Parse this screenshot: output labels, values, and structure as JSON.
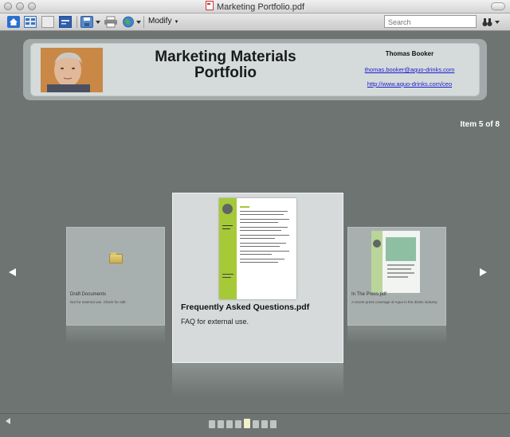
{
  "window": {
    "title": "Marketing Portfolio.pdf"
  },
  "toolbar": {
    "icons": [
      "home-icon",
      "layout-icon",
      "page-icon",
      "card-icon",
      "save-icon",
      "print-icon",
      "globe-icon"
    ],
    "modify_label": "Modify",
    "search_placeholder": "Search"
  },
  "header": {
    "title_line1": "Marketing Materials",
    "title_line2": "Portfolio",
    "author": "Thomas Booker",
    "email": "thomas.booker@aquo-drinks.com",
    "url": "http://www.aquo-drinks.com/ceo"
  },
  "status": {
    "item_count": "Item 5 of 8"
  },
  "carousel": {
    "center": {
      "name": "Frequently Asked Questions.pdf",
      "description": "FAQ for external use."
    },
    "left": {
      "name": "Draft Documents",
      "description": "Not for external use. Check for edit."
    },
    "right": {
      "name": "In The Press.pdf",
      "description": "A recent press coverage of Aquo in the drinks industry."
    }
  },
  "pager": {
    "total": 8,
    "current": 5
  },
  "colors": {
    "background": "#6d7472",
    "accent_green": "#a6c938",
    "link": "#1b1bd0"
  }
}
